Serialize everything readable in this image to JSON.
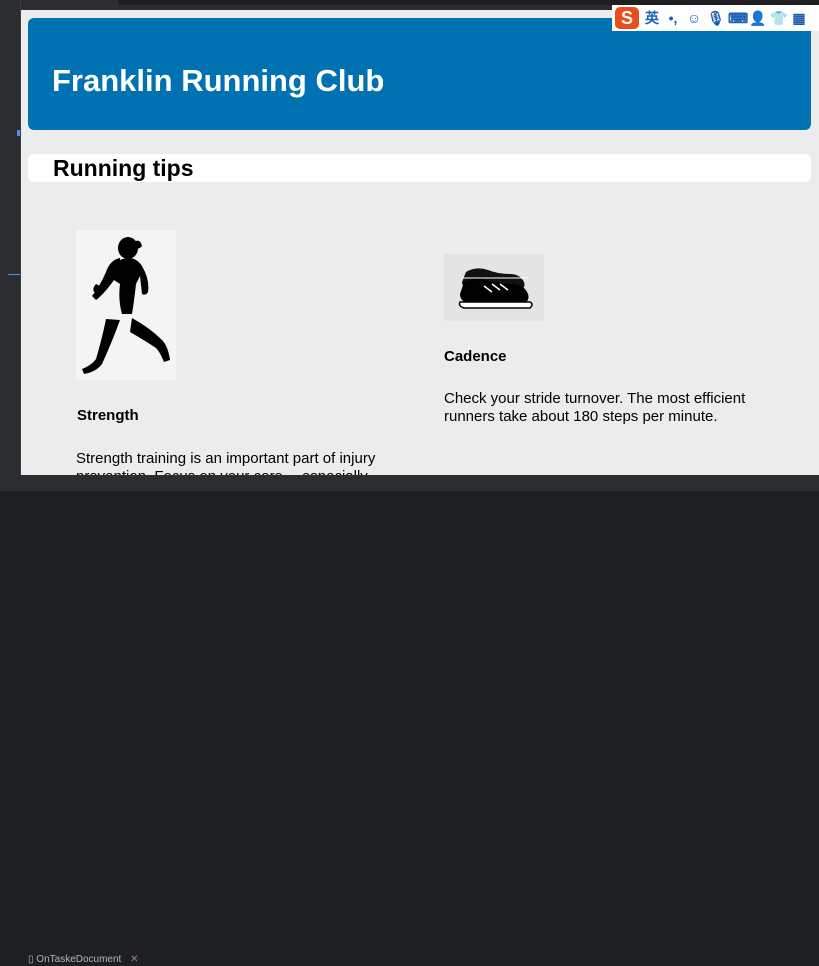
{
  "ide": {
    "bottom_tab": "OnTaskeDocument"
  },
  "ime_tray": {
    "logo": "S",
    "lang": "英",
    "punct": "•,",
    "icons": [
      "smiley-icon",
      "microphone-icon",
      "keyboard-icon",
      "user-icon",
      "shirt-icon",
      "grid-icon"
    ]
  },
  "page": {
    "banner_title": "Franklin Running Club",
    "section_title": "Running tips",
    "tips": [
      {
        "title": "Strength",
        "text": "Strength training is an important part of injury prevention. Focus on your core— especially",
        "image": "runner-silhouette"
      },
      {
        "title": "Cadence",
        "text": "Check your stride turnover. The most efficient runners take about 180 steps per minute.",
        "image": "running-shoes"
      }
    ]
  },
  "colors": {
    "banner": "#0072b1",
    "page_bg": "#ececec",
    "ide_bg": "#2b2d30"
  }
}
